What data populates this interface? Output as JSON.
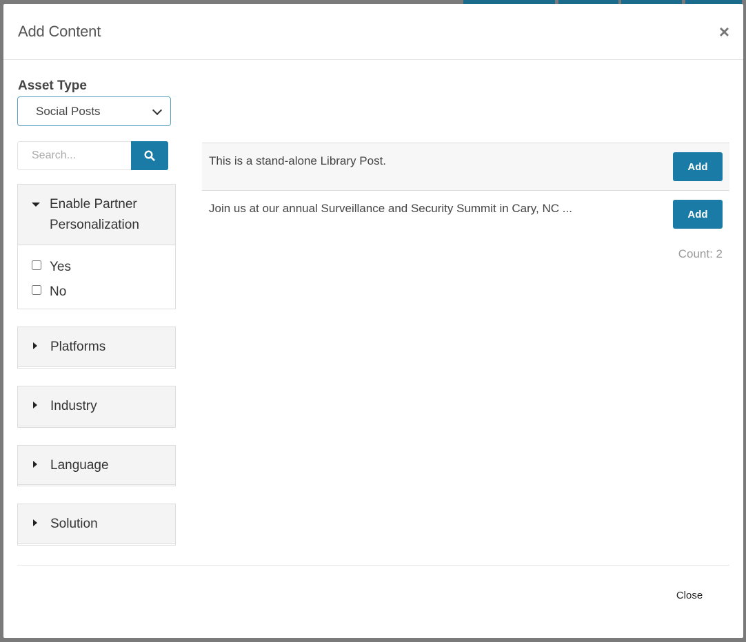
{
  "modal": {
    "title": "Add Content",
    "close_icon": "close-icon"
  },
  "filters": {
    "asset_type_label": "Asset Type",
    "asset_type_value": "Social Posts",
    "search_placeholder": "Search...",
    "facets": [
      {
        "title_line1": "Enable Partner",
        "title_line2": "Personalization",
        "expanded": true,
        "options": [
          "Yes",
          "No"
        ]
      },
      {
        "title": "Platforms",
        "expanded": false
      },
      {
        "title": "Industry",
        "expanded": false
      },
      {
        "title": "Language",
        "expanded": false
      },
      {
        "title": "Solution",
        "expanded": false
      }
    ]
  },
  "results": {
    "items": [
      {
        "text": "This is a stand-alone Library Post.",
        "button": "Add"
      },
      {
        "text": "Join us  at our annual Surveillance and Security Summit in Cary, NC ...",
        "button": "Add"
      }
    ],
    "count": "Count: 2"
  },
  "footer": {
    "close_label": "Close"
  },
  "colors": {
    "accent": "#1a7ca6",
    "select_border": "#5da3c5"
  }
}
